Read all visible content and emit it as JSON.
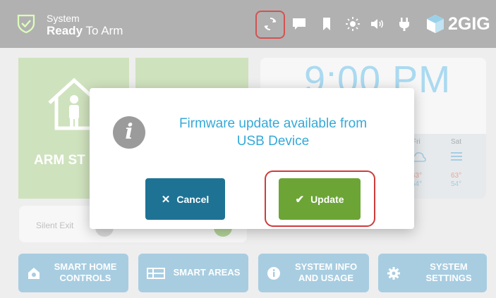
{
  "status": {
    "line1": "System",
    "line2_bold": "Ready",
    "line2_rest": "To Arm"
  },
  "topbar_icons": [
    "sync-icon",
    "chat-icon",
    "bookmark-icon",
    "brightness-icon",
    "volume-icon",
    "power-plug-icon"
  ],
  "brand": {
    "name": "2GIG"
  },
  "tiles": {
    "arm_stay_label": "ARM ST",
    "clock_time": "9:00 PM"
  },
  "weather": {
    "days": [
      {
        "day": "Fri",
        "hi": "63°",
        "lo": "54°"
      },
      {
        "day": "Sat",
        "hi": "63°",
        "lo": "54°"
      }
    ]
  },
  "silent_exit": {
    "label": "Silent Exit"
  },
  "bottom_buttons": [
    {
      "label": "SMART HOME CONTROLS",
      "line1": "SMART HOME",
      "line2": "CONTROLS",
      "icon": "home-gear-icon"
    },
    {
      "label": "SMART AREAS",
      "icon": "areas-icon"
    },
    {
      "label": "SYSTEM INFO AND USAGE",
      "line1": "SYSTEM INFO",
      "line2": "AND USAGE",
      "icon": "info-icon"
    },
    {
      "label": "SYSTEM SETTINGS",
      "line1": "SYSTEM",
      "line2": "SETTINGS",
      "icon": "gear-icon"
    }
  ],
  "modal": {
    "message_line1": "Firmware update available from",
    "message_line2": "USB Device",
    "cancel_label": "Cancel",
    "update_label": "Update"
  },
  "colors": {
    "topbar": "#a7a7a7",
    "accent_blue": "#35a9d8",
    "cancel_button": "#1e7395",
    "update_button": "#6ca536",
    "highlight": "#cf3b3b",
    "tile_green": "#c9dfb6",
    "tile_blue": "#9cc6dd"
  }
}
